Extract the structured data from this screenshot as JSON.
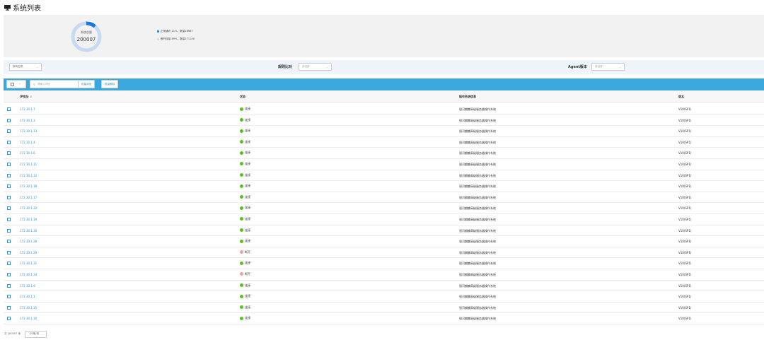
{
  "page": {
    "title": "系统列表"
  },
  "summary": {
    "donut_caption": "系统总量",
    "donut_value": "200007",
    "connected_ratio": 0.11,
    "legend": [
      {
        "text": "正常通讯 11%，数量28867",
        "color": "#1677e0"
      },
      {
        "text": "断开连接 89%，数量171140",
        "color": "#c9d9f2"
      }
    ]
  },
  "filters": {
    "host_select": "所有主机",
    "rule_label": "规则比对",
    "rule_select": "请选择",
    "agent_label": "Agent版本",
    "agent_select": "请选择"
  },
  "toolbar": {
    "search_placeholder": "请输入IP段",
    "btn_add": "批量添加",
    "btn_delete": "批量删除"
  },
  "table": {
    "headers": {
      "ip": "IP地址",
      "status": "状态",
      "os": "操作系统信息",
      "version": "版本"
    },
    "status_colors": {
      "connected": "#52c41a",
      "disconnected": "#f5a0a0"
    },
    "rows": [
      {
        "ip": "172.30.1.7",
        "status": "连接",
        "status_type": "connected",
        "os": "银河麒麟高级服务器操作系统",
        "version": "V10(SP1)"
      },
      {
        "ip": "172.30.1.3",
        "status": "连接",
        "status_type": "connected",
        "os": "银河麒麟高级服务器操作系统",
        "version": "V10(SP1)"
      },
      {
        "ip": "172.30.1.13",
        "status": "连接",
        "status_type": "connected",
        "os": "银河麒麟高级服务器操作系统",
        "version": "V10(SP1)"
      },
      {
        "ip": "172.30.1.4",
        "status": "连接",
        "status_type": "connected",
        "os": "银河麒麟高级服务器操作系统",
        "version": "V10(SP1)"
      },
      {
        "ip": "172.30.1.6",
        "status": "连接",
        "status_type": "connected",
        "os": "银河麒麟高级服务器操作系统",
        "version": "V10(SP1)"
      },
      {
        "ip": "172.30.1.11",
        "status": "连接",
        "status_type": "connected",
        "os": "银河麒麟高级服务器操作系统",
        "version": "V10(SP1)"
      },
      {
        "ip": "172.30.1.12",
        "status": "连接",
        "status_type": "connected",
        "os": "银河麒麟高级服务器操作系统",
        "version": "V10(SP1)"
      },
      {
        "ip": "172.30.1.18",
        "status": "连接",
        "status_type": "connected",
        "os": "银河麒麟高级服务器操作系统",
        "version": "V10(SP1)"
      },
      {
        "ip": "172.30.1.17",
        "status": "连接",
        "status_type": "connected",
        "os": "银河麒麟高级服务器操作系统",
        "version": "V10(SP1)"
      },
      {
        "ip": "172.30.1.22",
        "status": "连接",
        "status_type": "connected",
        "os": "银河麒麟高级服务器操作系统",
        "version": "V10(SP1)"
      },
      {
        "ip": "172.30.1.19",
        "status": "连接",
        "status_type": "connected",
        "os": "银河麒麟高级服务器操作系统",
        "version": "V10(SP1)"
      },
      {
        "ip": "172.30.1.30",
        "status": "连接",
        "status_type": "connected",
        "os": "银河麒麟高级服务器操作系统",
        "version": "V10(SP1)"
      },
      {
        "ip": "172.30.1.28",
        "status": "连接",
        "status_type": "connected",
        "os": "银河麒麟高级服务器操作系统",
        "version": "V10(SP1)"
      },
      {
        "ip": "172.30.1.29",
        "status": "断开",
        "status_type": "disconnected",
        "os": "银河麒麟高级服务器操作系统",
        "version": "V10(SP1)"
      },
      {
        "ip": "172.30.1.31",
        "status": "连接",
        "status_type": "connected",
        "os": "银河麒麟高级服务器操作系统",
        "version": "V10(SP1)"
      },
      {
        "ip": "172.30.1.34",
        "status": "断开",
        "status_type": "disconnected",
        "os": "银河麒麟高级服务器操作系统",
        "version": "V10(SP1)"
      },
      {
        "ip": "172.30.1.9",
        "status": "连接",
        "status_type": "connected",
        "os": "银河麒麟高级服务器操作系统",
        "version": "V10(SP1)"
      },
      {
        "ip": "172.30.1.1",
        "status": "连接",
        "status_type": "connected",
        "os": "银河麒麟高级服务器操作系统",
        "version": "V10(SP1)"
      },
      {
        "ip": "172.30.1.15",
        "status": "连接",
        "status_type": "connected",
        "os": "银河麒麟高级服务器操作系统",
        "version": "V10(SP1)"
      },
      {
        "ip": "172.30.1.10",
        "status": "连接",
        "status_type": "connected",
        "os": "银河麒麟高级服务器操作系统",
        "version": "V10(SP1)"
      }
    ]
  },
  "footer": {
    "total": "共 200007 条",
    "page_size": "20条/页"
  }
}
